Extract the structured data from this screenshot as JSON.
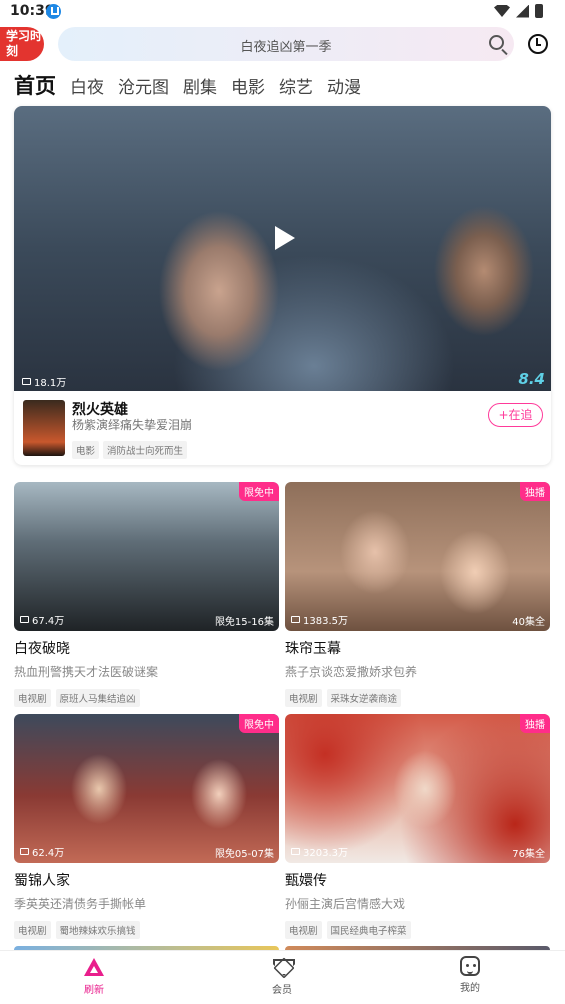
{
  "status_bar": {
    "time": "10:39"
  },
  "header": {
    "logo_text": "学习时刻",
    "search_placeholder": "白夜追凶第一季"
  },
  "tabs": [
    {
      "label": "首页",
      "active": true
    },
    {
      "label": "白夜"
    },
    {
      "label": "沧元图"
    },
    {
      "label": "剧集"
    },
    {
      "label": "电影"
    },
    {
      "label": "综艺"
    },
    {
      "label": "动漫"
    }
  ],
  "featured": {
    "views": "18.1万",
    "score": "8.4",
    "title": "烈火英雄",
    "subtitle": "杨紫演绎痛失挚爱泪崩",
    "tags": [
      "电影",
      "消防战士向死而生"
    ],
    "follow_label": "+在追"
  },
  "cards": [
    {
      "title": "白夜破晓",
      "subtitle": "热血刑警携天才法医破谜案",
      "views": "67.4万",
      "badge": "限免中",
      "episodes": "限免15-16集",
      "tags": [
        "电视剧",
        "原班人马集结追凶"
      ]
    },
    {
      "title": "珠帘玉幕",
      "subtitle": "燕子京谈恋爱撒娇求包养",
      "views": "1383.5万",
      "badge": "独播",
      "episodes": "40集全",
      "tags": [
        "电视剧",
        "采珠女逆袭商途"
      ]
    },
    {
      "title": "蜀锦人家",
      "subtitle": "季英英还清债务手撕帐单",
      "views": "62.4万",
      "badge": "限免中",
      "episodes": "限免05-07集",
      "tags": [
        "电视剧",
        "蜀地辣妹欢乐搞钱"
      ]
    },
    {
      "title": "甄嬛传",
      "subtitle": "孙俪主演后宫情感大戏",
      "views": "3203.3万",
      "badge": "独播",
      "episodes": "76集全",
      "tags": [
        "电视剧",
        "国民经典电子榨菜"
      ]
    }
  ],
  "bottom_nav": [
    {
      "label": "刷新",
      "icon": "discover-icon",
      "active": true
    },
    {
      "label": "会员",
      "icon": "vip-diamond-icon"
    },
    {
      "label": "我的",
      "icon": "profile-icon"
    }
  ]
}
